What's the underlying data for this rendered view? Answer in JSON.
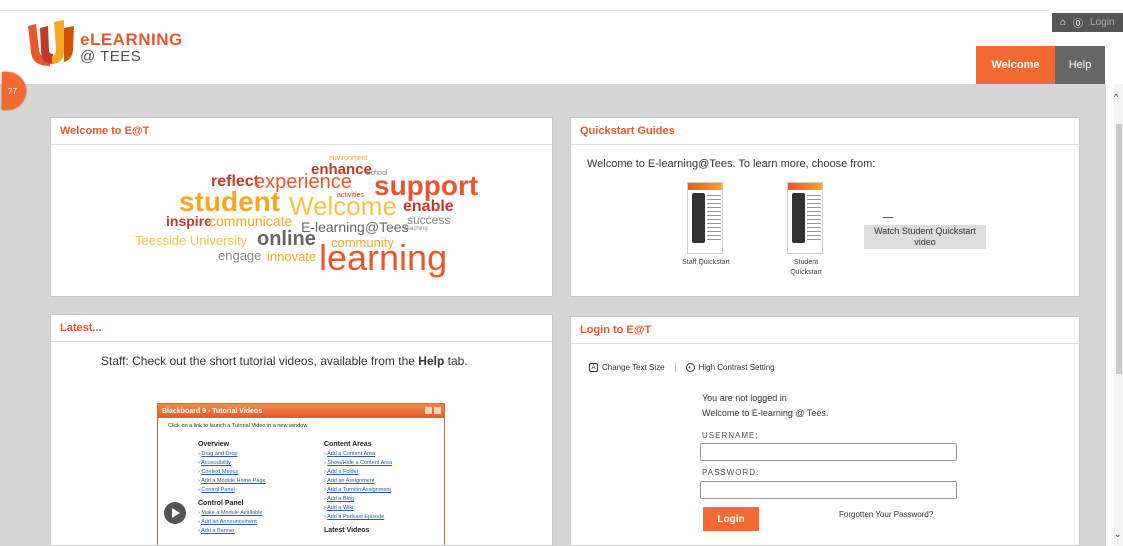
{
  "header": {
    "brand_line1": "eLEARNING",
    "brand_line2": "@ TEES",
    "util": {
      "home_icon": "⌂",
      "help_icon": "⓪",
      "login": "Login"
    },
    "tabs": [
      {
        "label": "Welcome"
      },
      {
        "label": "Help"
      }
    ],
    "badge": "77"
  },
  "colors": {
    "accent": "#f26a32",
    "dark": "#555555",
    "link": "#2a5db0"
  },
  "welcome": {
    "title": "Welcome to E@T",
    "cloud": [
      "environment",
      "enhance",
      "School",
      "reflect",
      "experience",
      "support",
      "activities",
      "student",
      "Welcome",
      "enable",
      "inspire",
      "communicate",
      "success",
      "E-learning@Tees",
      "teaching",
      "Teesside University",
      "online",
      "community",
      "engage",
      "innovate",
      "learning"
    ]
  },
  "quickstart": {
    "title": "Quickstart Guides",
    "intro": "Welcome to E-learning@Tees. To learn more, choose from:",
    "staff": "Staff Quickstart",
    "student": "Student Quickstart",
    "video": "Watch Student Quickstart video"
  },
  "latest": {
    "title": "Latest...",
    "text_before": "Staff: Check out the short tutorial videos, available from the ",
    "text_bold": "Help",
    "text_after": " tab.",
    "tutorial": {
      "title": "Blackboard 9 - Tutorial Videos",
      "info": "Click on a link to launch a Tutorial Video in a new window.",
      "overview": {
        "heading": "Overview",
        "links": [
          "Drag and Drop",
          "Accessibility",
          "Context Menus",
          "Add a Module Home Page",
          "Control Panel"
        ]
      },
      "control_panel": {
        "heading": "Control Panel",
        "links": [
          "Make a Module Available",
          "Add an Announcement",
          "Add a Banner"
        ]
      },
      "content_areas": {
        "heading": "Content Areas",
        "links": [
          "Add a Content Area",
          "Show/Hide a Content Area",
          "Add a Folder",
          "Add an Assignment",
          "Add a Turnitin Assignment",
          "Add a Blog",
          "Add a Wiki",
          "Add a Podcast Episode"
        ]
      },
      "latest_videos": {
        "heading": "Latest Videos"
      }
    }
  },
  "login": {
    "title": "Login to E@T",
    "text_size": "Change Text Size",
    "contrast": "High Contrast Setting",
    "not_logged": "You are not logged in",
    "welcome": "Welcome to E-learning @ Tees.",
    "username_label": "USERNAME:",
    "password_label": "PASSWORD:",
    "username_value": "",
    "password_value": "",
    "button": "Login",
    "forgot": "Forgotten Your Password?"
  }
}
